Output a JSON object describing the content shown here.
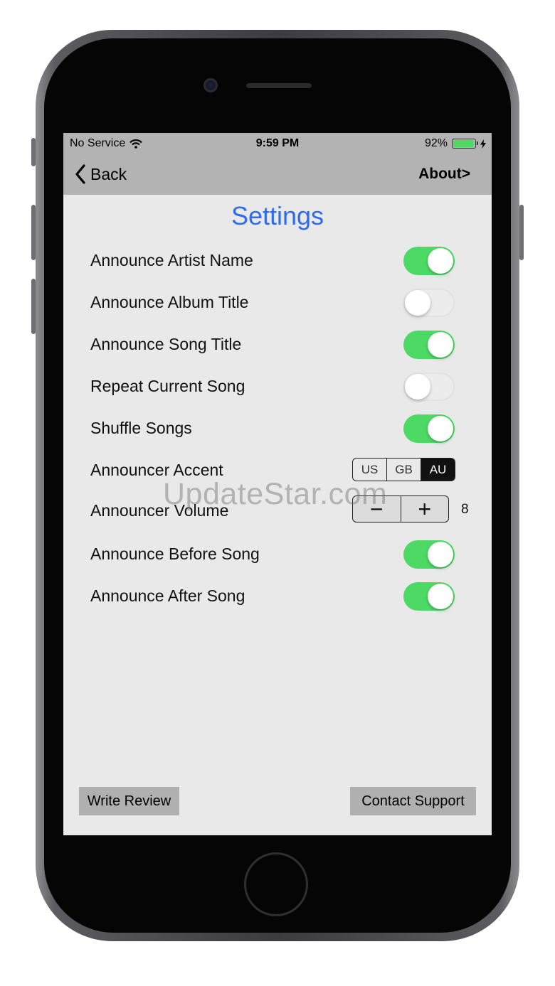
{
  "status_bar": {
    "carrier": "No Service",
    "time": "9:59 PM",
    "battery_percent": "92%",
    "battery_level": 0.92,
    "charging_icon": "bolt-icon"
  },
  "nav": {
    "back_label": "Back",
    "about_label": "About>"
  },
  "page": {
    "title": "Settings"
  },
  "settings": [
    {
      "label": "Announce Artist Name",
      "on": true
    },
    {
      "label": "Announce Album Title",
      "on": false
    },
    {
      "label": "Announce Song Title",
      "on": true
    },
    {
      "label": "Repeat Current Song",
      "on": false
    },
    {
      "label": "Shuffle Songs",
      "on": true
    }
  ],
  "accent": {
    "label": "Announcer Accent",
    "options": [
      "US",
      "GB",
      "AU"
    ],
    "selected": "AU"
  },
  "volume": {
    "label": "Announcer Volume",
    "minus": "−",
    "plus": "+",
    "value": "8"
  },
  "settings2": [
    {
      "label": "Announce Before Song",
      "on": true
    },
    {
      "label": "Announce After Song",
      "on": true
    }
  ],
  "buttons": {
    "write_review": "Write Review",
    "contact_support": "Contact Support"
  },
  "watermark": "UpdateStar.com",
  "colors": {
    "accent_blue": "#2d6cf0",
    "toggle_on": "#4cd964",
    "bar_gray": "#b3b3b3",
    "screen_bg": "#e9e9e9"
  }
}
